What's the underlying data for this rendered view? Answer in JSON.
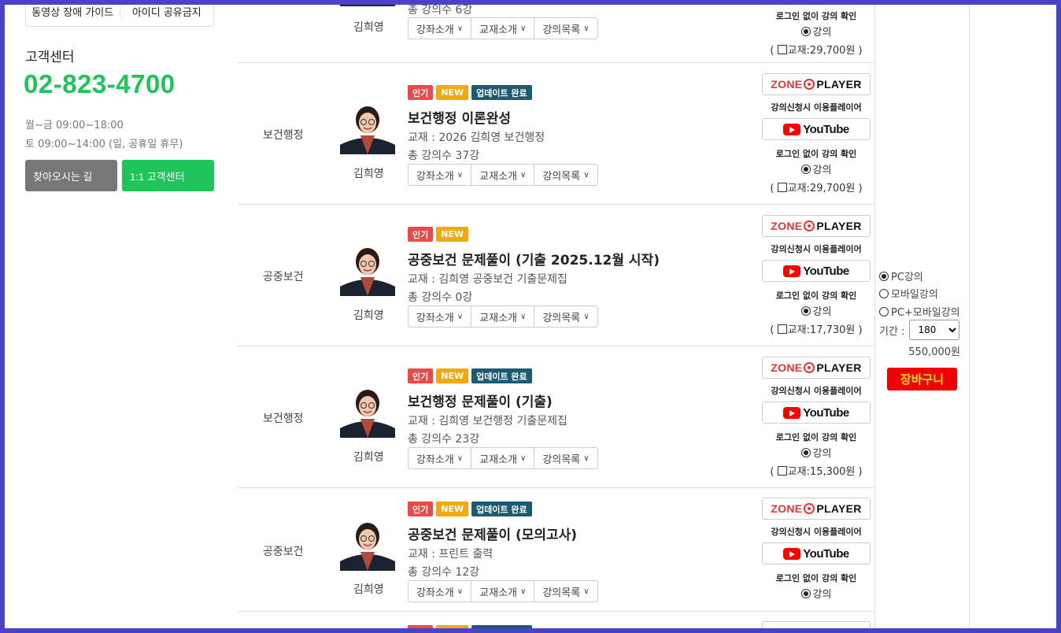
{
  "sidebar": {
    "guide_label": "동영상 장애 가이드",
    "id_share_label": "아이디 공유금지",
    "cs_title": "고객센터",
    "phone": "02-823-4700",
    "hours_weekday": "월~금 09:00~18:00",
    "hours_saturday": "토 09:00~14:00 (일, 공휴일 휴무)",
    "directions_button": "찾아오시는 길",
    "cs_button": "1:1 고객센터"
  },
  "common": {
    "tab_intro": "강좌소개",
    "tab_book": "교재소개",
    "tab_list": "강의목록",
    "player_note": "강의신청시 이용플레이어",
    "zone_left": "ZONE",
    "zone_right": "PLAYER",
    "youtube": "YouTube",
    "no_login_note": "로그인 없이 강의 확인",
    "lecture_option": "강의",
    "badge_popular": "인기",
    "badge_new": "NEW",
    "badge_updated": "업데이트 완료",
    "book_label": "교재 : ",
    "teacher": "김희영"
  },
  "courses": [
    {
      "category": "",
      "title": "",
      "book": "",
      "count": "총 강의수 6강",
      "book_price": "( 교재:29,700원 )"
    },
    {
      "category": "보건행정",
      "title": "보건행정 이론완성",
      "book": "2026 김희영 보건행정",
      "count": "총 강의수 37강",
      "book_price": "( 교재:29,700원 )"
    },
    {
      "category": "공중보건",
      "title": "공중보건 문제풀이 (기출 2025.12월 시작)",
      "book": "김희영 공중보건 기출문제집",
      "count": "총 강의수 0강",
      "book_price": "( 교재:17,730원 )"
    },
    {
      "category": "보건행정",
      "title": "보건행정 문제풀이 (기출)",
      "book": "김희영 보건행정 기출문제집",
      "count": "총 강의수 23강",
      "book_price": "( 교재:15,300원 )"
    },
    {
      "category": "공중보건",
      "title": "공중보건 문제풀이 (모의고사)",
      "book": "프린트 출력",
      "count": "총 강의수 12강",
      "book_price": ""
    }
  ],
  "purchase": {
    "opt_pc": "PC강의",
    "opt_mobile": "모바일강의",
    "opt_both": "PC+모바일강의",
    "period_label": "기간 :",
    "period_value": "180",
    "price": "550,000원",
    "cart_button": "장바구니"
  }
}
